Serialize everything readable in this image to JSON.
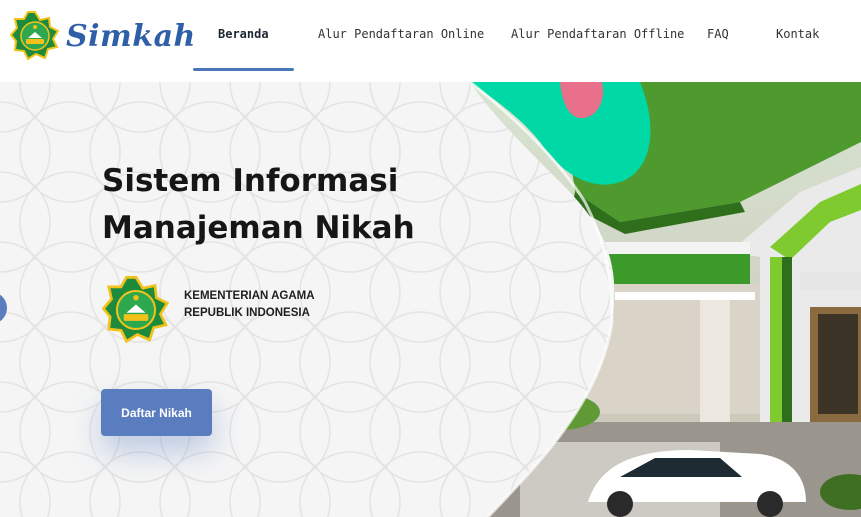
{
  "brand": {
    "name": "Simkah",
    "color": "#2f5fa6",
    "emblem_icon": "kemenag-emblem-icon"
  },
  "nav": {
    "active_index": 0,
    "items": [
      {
        "label": "Beranda"
      },
      {
        "label": "Alur Pendaftaran Online"
      },
      {
        "label": "Alur Pendaftaran Offline"
      },
      {
        "label": "FAQ"
      },
      {
        "label": "Kontak"
      }
    ],
    "underline_color": "#4a78b5"
  },
  "hero": {
    "title_line1": "Sistem Informasi",
    "title_line2": "Manajeman Nikah",
    "ministry_line1": "KEMENTERIAN AGAMA",
    "ministry_line2": "REPUBLIK INDONESIA",
    "cta_label": "Daftar Nikah",
    "cta_color": "#5a7dbf",
    "accent_teal": "#00d8a6",
    "accent_pink": "#e8708b"
  }
}
